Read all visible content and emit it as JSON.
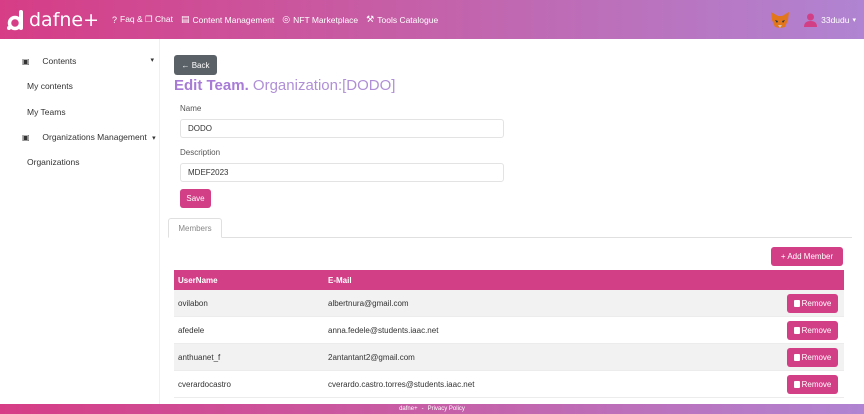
{
  "brand": {
    "name": "dafne+"
  },
  "nav": [
    {
      "icon": "question-icon",
      "glyph": "?",
      "label": "Faq & ❒ Chat"
    },
    {
      "icon": "content-icon",
      "glyph": "▤",
      "label": "Content Management"
    },
    {
      "icon": "nft-icon",
      "glyph": "◎",
      "label": "NFT Marketplace"
    },
    {
      "icon": "tools-icon",
      "glyph": "⚒",
      "label": "Tools Catalogue"
    }
  ],
  "user": {
    "name": "33dudu",
    "caret": "▾"
  },
  "sidebar": {
    "contents": {
      "label": "Contents",
      "caret": "▾"
    },
    "my_contents": "My contents",
    "my_teams": "My Teams",
    "org_mgmt": {
      "label": "Organizations Management",
      "caret": "▾"
    },
    "organizations": "Organizations"
  },
  "main": {
    "back_label": "← Back",
    "title_bold": "Edit Team.",
    "title_rest": " Organization:[DODO]",
    "name_label": "Name",
    "name_value": "DODO",
    "description_label": "Description",
    "description_value": "MDEF2023",
    "save_label": "Save",
    "tab_members": "Members",
    "add_member_label": "+ Add Member",
    "table": {
      "headers": [
        "UserName",
        "E-Mail"
      ],
      "remove_label": "Remove",
      "rows": [
        {
          "username": "ovilabon",
          "email": "albertnura@gmail.com"
        },
        {
          "username": "afedele",
          "email": "anna.fedele@students.iaac.net"
        },
        {
          "username": "anthuanet_f",
          "email": "2antantant2@gmail.com"
        },
        {
          "username": "cverardocastro",
          "email": "cverardo.castro.torres@students.iaac.net"
        }
      ]
    }
  },
  "footer": {
    "brand": "dafne+",
    "separator": "-",
    "link": "Privacy Policy"
  },
  "colors": {
    "primary": "#d23f86",
    "accent": "#b08fd6",
    "back": "#5a6268"
  }
}
